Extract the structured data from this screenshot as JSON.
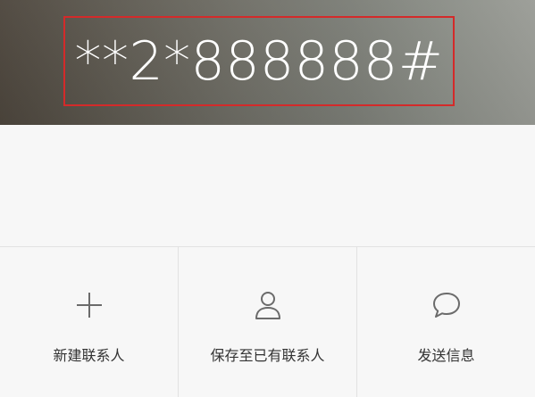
{
  "dialer": {
    "number": "**2*888888#",
    "highlight_color": "#d42a2a"
  },
  "actions": [
    {
      "label": "新建联系人",
      "icon": "plus-icon"
    },
    {
      "label": "保存至已有联系人",
      "icon": "person-icon"
    },
    {
      "label": "发送信息",
      "icon": "chat-bubble-icon"
    }
  ],
  "colors": {
    "icon": "#6b6b6b",
    "label": "#333333",
    "background": "#f7f7f7"
  }
}
